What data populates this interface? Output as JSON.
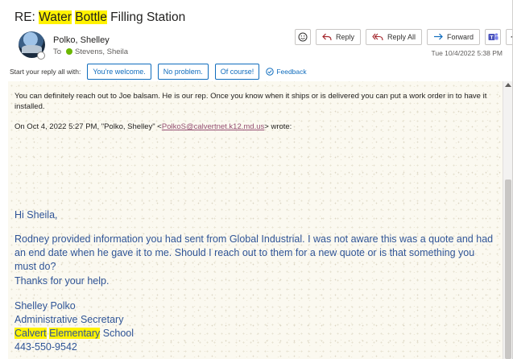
{
  "email": {
    "subject_prefix": "RE: ",
    "subject_hl1": "Water",
    "subject_sp1": " ",
    "subject_hl2": "Bottle",
    "subject_rest": " Filling Station",
    "sender": "Polko, Shelley",
    "to_label": "To",
    "recipient": "Stevens, Sheila",
    "date": "Tue 10/4/2022 5:38 PM"
  },
  "toolbar": {
    "emoji_icon": "smiley-icon",
    "reply_label": "Reply",
    "reply_all_label": "Reply All",
    "forward_label": "Forward",
    "teams_icon": "teams-icon",
    "more_label": "···"
  },
  "quick_replies": {
    "prompt": "Start your reply all with:",
    "options": [
      "You're welcome.",
      "No problem.",
      "Of course!"
    ],
    "feedback_label": "Feedback"
  },
  "body": {
    "reply_text": "You can definitely reach out to Joe balsam. He is our rep. Once you know when it ships or is delivered you can put a work order in to have it installed.",
    "quote_header_pre": "On Oct 4, 2022 5:27 PM, \"Polko, Shelley\" <",
    "quote_email": "PolkoS@calvertnet.k12.md.us",
    "quote_header_post": "> wrote:",
    "greeting": "Hi Sheila,",
    "paragraph": "Rodney provided information you had sent from Global Industrial. I was not aware this was a quote and had an end date when he gave it to me. Should I reach out to them for a new quote or is that something you must do?",
    "thanks": "Thanks for your help.",
    "sig_name": "Shelley Polko",
    "sig_title": "Administrative Secretary",
    "sig_school_hl1": "Calvert",
    "sig_school_sp": " ",
    "sig_school_hl2": "Elementary",
    "sig_school_rest": " School",
    "sig_phone": "443-550-9542"
  },
  "colors": {
    "accent": "#0f6cbd",
    "highlight": "#fff200",
    "quoted_text": "#2f5496",
    "presence_green": "#6bb700"
  }
}
